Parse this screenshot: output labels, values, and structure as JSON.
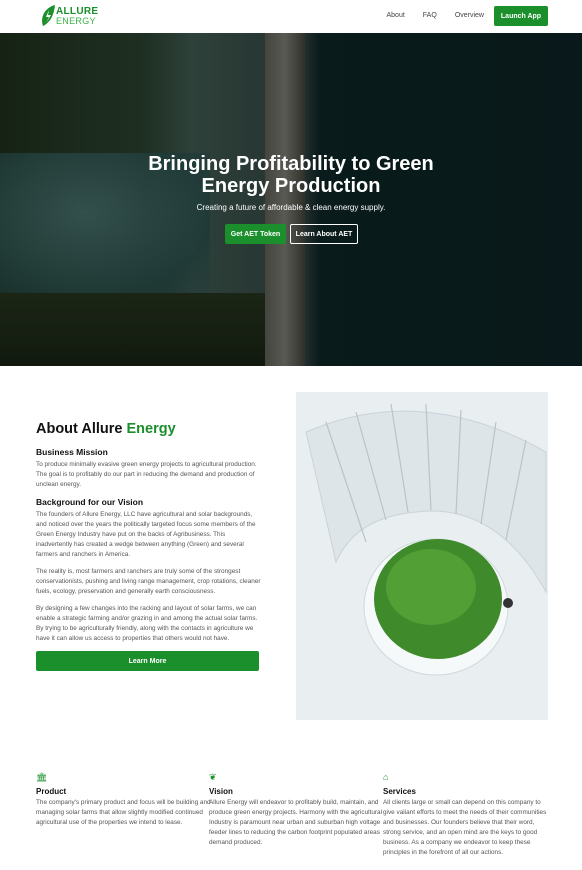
{
  "nav": {
    "logo_line1": "ALLURE",
    "logo_line2": "ENERGY",
    "links": [
      "About",
      "FAQ",
      "Overview"
    ],
    "launch": "Launch App"
  },
  "hero": {
    "title": "Bringing Profitability to Green Energy Production",
    "subtitle": "Creating a future of affordable & clean energy supply.",
    "btn_primary": "Get AET Token",
    "btn_secondary": "Learn About AET"
  },
  "about": {
    "title_a": "About Allure ",
    "title_b": "Energy",
    "mission_heading": "Business Mission",
    "mission_text": "To produce minimally evasive green energy projects to agricultural production. The goal is to profitably do our part in reducing the demand and production of unclean energy.",
    "vision_heading": "Background for our Vision",
    "p1": "The founders of Allure Energy, LLC have agricultural and solar backgrounds, and noticed over the years the politically targeted focus some members of the Green Energy Industry have put on the backs of Agribusiness. This inadvertently has created a wedge between anything (Green) and several farmers and ranchers in America.",
    "p2": "The reality is, most farmers and ranchers are truly some of the strongest conservationists, pushing and living range management, crop rotations, cleaner fuels, ecology, preservation and generally earth consciousness.",
    "p3": "By designing a few changes into the racking and layout of solar farms, we can enable a strategic farming and/or grazing in and among the actual solar farms. By trying to be agriculturally friendly, along with the contacts in agriculture we have it can allow us access to properties that others would not have.",
    "learn_more": "Learn More"
  },
  "features": [
    {
      "icon": "bank-icon",
      "title": "Product",
      "text": "The company's primary product and focus will be building and managing solar farms that allow slightly modified continued agricultural use of the properties we intend to lease."
    },
    {
      "icon": "seedling-icon",
      "title": "Vision",
      "text": "Allure Energy will endeavor to profitably build, maintain, and produce green energy projects. Harmony with the agricultural Industry is paramount near urban and suburban high voltage feeder lines to reducing the carbon footprint populated areas demand produced."
    },
    {
      "icon": "home-icon",
      "title": "Services",
      "text": "All clients large or small can depend on this company to give valiant efforts to meet the needs of their communities and businesses. Our founders believe that their word, strong service, and an open mind are the keys to good business. As a company we endeavor to keep these principles in the forefront of all our actions."
    }
  ],
  "colors": {
    "accent": "#1a8f2b"
  }
}
